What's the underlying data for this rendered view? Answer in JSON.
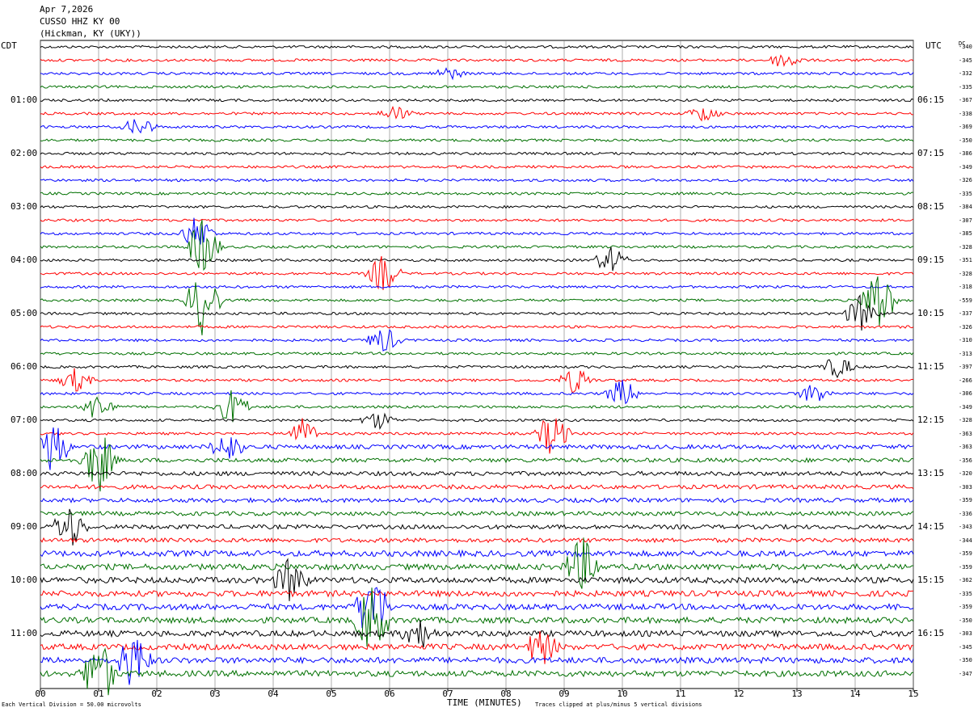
{
  "header": {
    "date": "Apr 7,2026",
    "station": "CUSSO HHZ KY 00",
    "location": "(Hickman, KY (UKY))"
  },
  "left_zone": "CDT",
  "right_zone": "UTC",
  "dc_label": "DC",
  "left_hour_labels": [
    "01:00",
    "02:00",
    "03:00",
    "04:00",
    "05:00",
    "06:00",
    "07:00",
    "08:00",
    "09:00",
    "10:00",
    "11:00"
  ],
  "right_hour_labels": [
    "06:15",
    "07:15",
    "08:15",
    "09:15",
    "10:15",
    "11:15",
    "12:15",
    "13:15",
    "14:15",
    "15:15",
    "16:15"
  ],
  "footer": {
    "scale_note": "Each Vertical Division = 50.00 microvolts",
    "xlabel": "TIME (MINUTES)",
    "clip_note": "Traces clipped at plus/minus 5 vertical divisions"
  },
  "chart_data": {
    "type": "line",
    "xlabel": "TIME (MINUTES)",
    "xlim": [
      0,
      15
    ],
    "x_ticks": [
      "00",
      "01",
      "02",
      "03",
      "04",
      "05",
      "06",
      "07",
      "08",
      "09",
      "10",
      "11",
      "12",
      "13",
      "14",
      "15"
    ],
    "trace_count": 48,
    "trace_interval_minutes": 15,
    "trace_colors": [
      "#000000",
      "#ff0000",
      "#0000ff",
      "#007000"
    ],
    "dc_offsets": [
      "-340",
      "-345",
      "-332",
      "-335",
      "-367",
      "-338",
      "-369",
      "-350",
      "-386",
      "-349",
      "-326",
      "-335",
      "-384",
      "-307",
      "-385",
      "-328",
      "-351",
      "-328",
      "-318",
      "-559",
      "-337",
      "-326",
      "-310",
      "-313",
      "-397",
      "-266",
      "-306",
      "-349",
      "-328",
      "-363",
      "-363",
      "-356",
      "-320",
      "-303",
      "-359",
      "-336",
      "-343",
      "-344",
      "-359",
      "-359",
      "-362",
      "-335",
      "-359",
      "-350",
      "-303",
      "-345",
      "-350",
      "-347"
    ],
    "events": [
      {
        "trace": 1,
        "minute": 12.8,
        "amp": 1.2
      },
      {
        "trace": 2,
        "minute": 7.0,
        "amp": 0.8
      },
      {
        "trace": 5,
        "minute": 6.1,
        "amp": 1.0
      },
      {
        "trace": 5,
        "minute": 11.4,
        "amp": 1.1
      },
      {
        "trace": 6,
        "minute": 1.7,
        "amp": 1.3
      },
      {
        "trace": 14,
        "minute": 2.7,
        "amp": 2.5
      },
      {
        "trace": 15,
        "minute": 2.8,
        "amp": 4.0
      },
      {
        "trace": 16,
        "minute": 9.8,
        "amp": 1.8
      },
      {
        "trace": 17,
        "minute": 5.9,
        "amp": 2.6
      },
      {
        "trace": 19,
        "minute": 2.8,
        "amp": 5.0
      },
      {
        "trace": 19,
        "minute": 14.4,
        "amp": 5.0
      },
      {
        "trace": 20,
        "minute": 14.1,
        "amp": 2.5
      },
      {
        "trace": 22,
        "minute": 5.9,
        "amp": 1.8
      },
      {
        "trace": 24,
        "minute": 13.7,
        "amp": 1.5
      },
      {
        "trace": 25,
        "minute": 0.6,
        "amp": 1.6
      },
      {
        "trace": 25,
        "minute": 9.2,
        "amp": 1.8
      },
      {
        "trace": 26,
        "minute": 10.0,
        "amp": 2.0
      },
      {
        "trace": 26,
        "minute": 13.3,
        "amp": 1.4
      },
      {
        "trace": 27,
        "minute": 3.3,
        "amp": 2.5
      },
      {
        "trace": 27,
        "minute": 1.0,
        "amp": 2.0
      },
      {
        "trace": 28,
        "minute": 5.8,
        "amp": 1.2
      },
      {
        "trace": 29,
        "minute": 4.5,
        "amp": 2.0
      },
      {
        "trace": 29,
        "minute": 8.8,
        "amp": 3.0
      },
      {
        "trace": 30,
        "minute": 0.2,
        "amp": 4.0
      },
      {
        "trace": 30,
        "minute": 3.2,
        "amp": 2.0
      },
      {
        "trace": 31,
        "minute": 1.0,
        "amp": 4.5
      },
      {
        "trace": 36,
        "minute": 0.5,
        "amp": 3.0
      },
      {
        "trace": 39,
        "minute": 9.3,
        "amp": 4.0
      },
      {
        "trace": 40,
        "minute": 4.3,
        "amp": 3.0
      },
      {
        "trace": 42,
        "minute": 5.7,
        "amp": 5.0
      },
      {
        "trace": 43,
        "minute": 5.7,
        "amp": 5.0
      },
      {
        "trace": 44,
        "minute": 6.5,
        "amp": 2.0
      },
      {
        "trace": 45,
        "minute": 8.6,
        "amp": 2.5
      },
      {
        "trace": 46,
        "minute": 1.6,
        "amp": 4.0
      },
      {
        "trace": 47,
        "minute": 1.0,
        "amp": 5.0
      }
    ]
  }
}
